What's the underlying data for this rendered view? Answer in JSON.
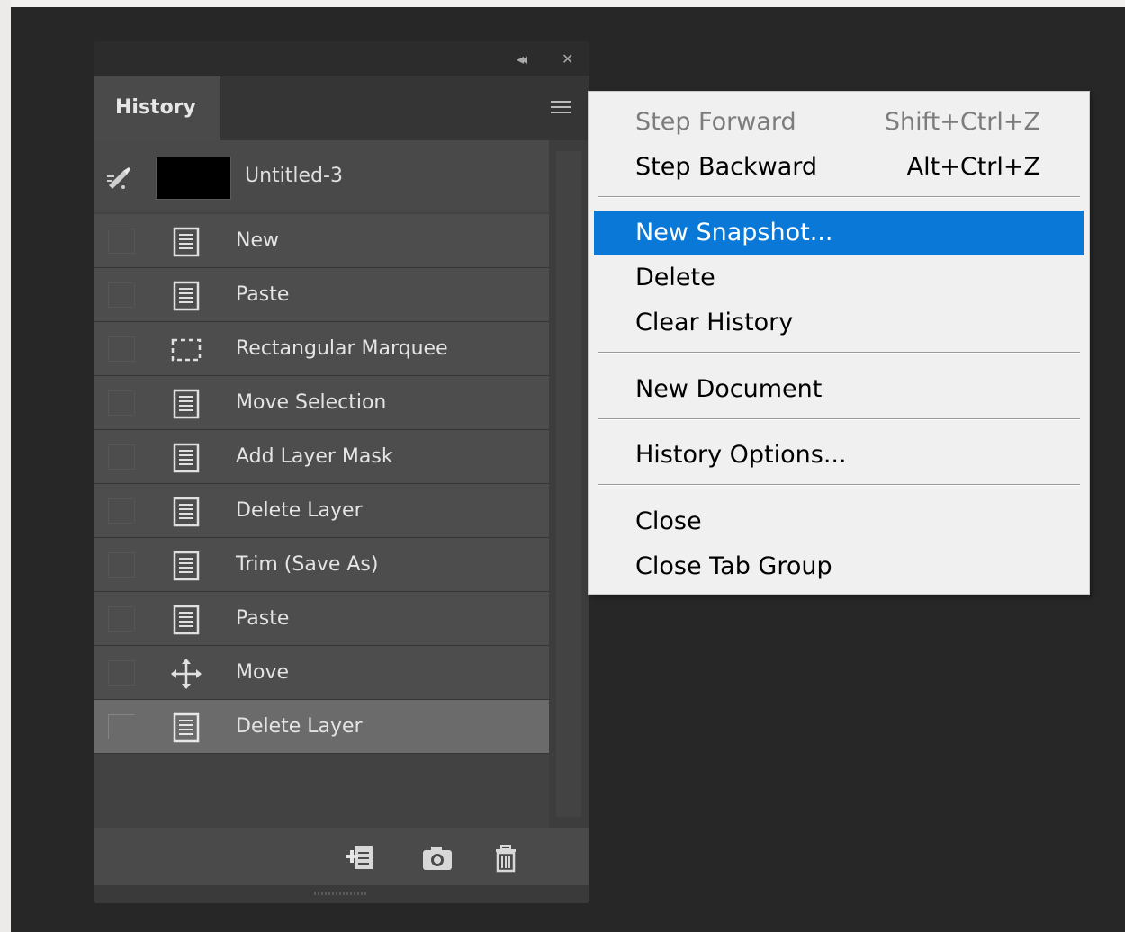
{
  "panel": {
    "collapse_glyph": "◂◂",
    "close_glyph": "✕",
    "tab_label": "History",
    "menu_icon": "hamburger-icon",
    "snapshot": {
      "label": "Untitled-3",
      "icon": "history-brush-icon"
    },
    "states": [
      {
        "label": "New",
        "icon": "document-icon"
      },
      {
        "label": "Paste",
        "icon": "document-icon"
      },
      {
        "label": "Rectangular Marquee",
        "icon": "marquee-icon"
      },
      {
        "label": "Move Selection",
        "icon": "document-icon"
      },
      {
        "label": "Add Layer Mask",
        "icon": "document-icon"
      },
      {
        "label": "Delete Layer",
        "icon": "document-icon"
      },
      {
        "label": "Trim (Save As)",
        "icon": "document-icon"
      },
      {
        "label": "Paste",
        "icon": "document-icon"
      },
      {
        "label": "Move",
        "icon": "move-icon"
      },
      {
        "label": "Delete Layer",
        "icon": "document-icon",
        "active": true
      }
    ],
    "footer_icons": [
      "new-document-from-state-icon",
      "camera-icon",
      "trash-icon"
    ]
  },
  "context_menu": {
    "items": [
      {
        "label": "Step Forward",
        "shortcut": "Shift+Ctrl+Z",
        "disabled": true
      },
      {
        "label": "Step Backward",
        "shortcut": "Alt+Ctrl+Z"
      },
      {
        "label": "New Snapshot...",
        "highlighted": true
      },
      {
        "label": "Delete"
      },
      {
        "label": "Clear History"
      },
      {
        "label": "New Document"
      },
      {
        "label": "History Options..."
      },
      {
        "label": "Close"
      },
      {
        "label": "Close Tab Group"
      }
    ]
  },
  "colors": {
    "highlight": "#0a78d7",
    "background": "#272727",
    "panel": "#424242",
    "menu": "#f0f0f0"
  }
}
